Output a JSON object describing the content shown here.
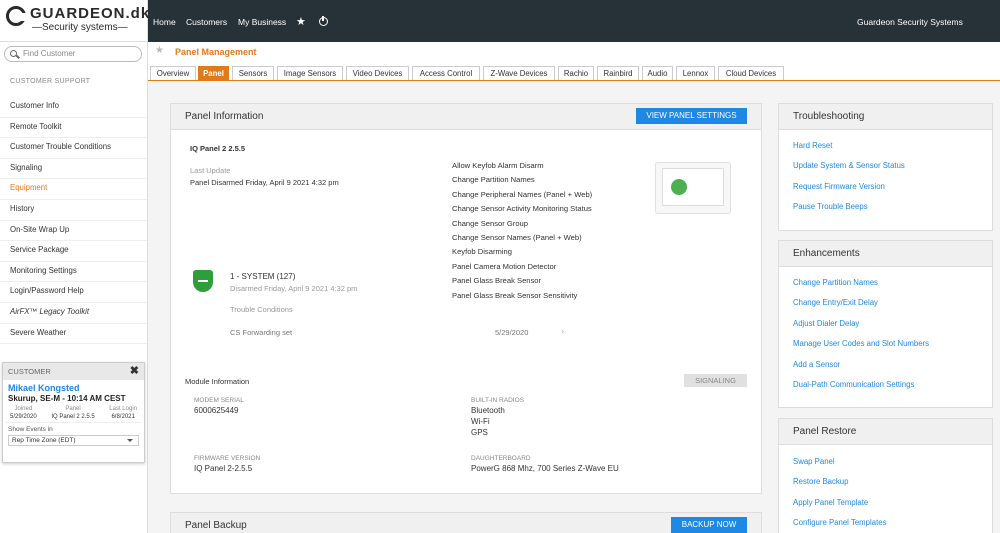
{
  "brand": {
    "name": "GUARDEON.dk",
    "sub": "Security systems"
  },
  "search": {
    "placeholder": "Find Customer"
  },
  "sidebar": {
    "section_title": "CUSTOMER SUPPORT",
    "items": [
      "Customer Info",
      "Remote Toolkit",
      "Customer Trouble Conditions",
      "Signaling",
      "Equipment",
      "History",
      "On-Site Wrap Up",
      "Service Package",
      "Monitoring Settings",
      "Login/Password Help",
      "AirFX™ Legacy Toolkit",
      "Severe Weather"
    ],
    "active_item": "Equipment"
  },
  "customer": {
    "header": "CUSTOMER",
    "name": "Mikael Kongsted",
    "location": "Skurup, SE-M - 10:14 AM CEST",
    "joined_label": "Joined",
    "joined": "5/29/2020",
    "panel_label": "Panel",
    "panel": "IQ Panel 2 2.5.5",
    "lastlogin_label": "Last Login",
    "lastlogin": "6/8/2021",
    "events_label": "Show Events in",
    "events_value": "Rep Time Zone (EDT)"
  },
  "topnav": {
    "home": "Home",
    "customers": "Customers",
    "mybusiness": "My Business",
    "company": "Guardeon Security Systems"
  },
  "page": {
    "title": "Panel Management"
  },
  "tabs": [
    "Overview",
    "Panel",
    "Sensors",
    "Image Sensors",
    "Video Devices",
    "Access Control",
    "Z-Wave Devices",
    "Rachio",
    "Rainbird",
    "Audio",
    "Lennox",
    "Cloud Devices"
  ],
  "active_tab": "Panel",
  "panel_info": {
    "title": "Panel Information",
    "button": "VIEW PANEL SETTINGS",
    "model": "IQ Panel 2 2.5.5",
    "last_update_label": "Last Update",
    "last_update": "Panel Disarmed Friday, April 9 2021 4:32 pm",
    "features": [
      "Allow Keyfob Alarm Disarm",
      "Change Partition Names",
      "Change Peripheral Names (Panel + Web)",
      "Change Sensor Activity Monitoring Status",
      "Change Sensor Group",
      "Change Sensor Names (Panel + Web)",
      "Keyfob Disarming",
      "Panel Camera Motion Detector",
      "Panel Glass Break Sensor",
      "Panel Glass Break Sensor Sensitivity"
    ],
    "system": "1 - SYSTEM (127)",
    "system_status": "Disarmed Friday, April 9 2021 4:32 pm",
    "trouble": "Trouble Conditions",
    "cs_forwarding": "CS Forwarding set",
    "cs_date": "5/29/2020",
    "module_info": "Module Information",
    "signaling": "SIGNALING",
    "modem_serial_label": "MODEM SERIAL",
    "modem_serial": "6000625449",
    "radios_label": "BUILT-IN RADIOS",
    "radios": [
      "Bluetooth",
      "Wi-Fi",
      "GPS"
    ],
    "firmware_label": "FIRMWARE VERSION",
    "firmware": "IQ Panel 2-2.5.5",
    "daughterboard_label": "DAUGHTERBOARD",
    "daughterboard": "PowerG 868 Mhz, 700 Series Z-Wave EU"
  },
  "panel_backup": {
    "title": "Panel Backup",
    "button": "BACKUP NOW"
  },
  "troubleshooting": {
    "title": "Troubleshooting",
    "links": [
      "Hard Reset",
      "Update System & Sensor Status",
      "Request Firmware Version",
      "Pause Trouble Beeps"
    ]
  },
  "enhancements": {
    "title": "Enhancements",
    "links": [
      "Change Partition Names",
      "Change Entry/Exit Delay",
      "Adjust Dialer Delay",
      "Manage User Codes and Slot Numbers",
      "Add a Sensor",
      "Dual-Path Communication Settings"
    ]
  },
  "panel_restore": {
    "title": "Panel Restore",
    "links": [
      "Swap Panel",
      "Restore Backup",
      "Apply Panel Template",
      "Configure Panel Templates"
    ]
  },
  "colors": {
    "accent": "#e07b1a",
    "link": "#1e88e5",
    "topbar": "#263238",
    "ok": "#2e9e3a"
  }
}
